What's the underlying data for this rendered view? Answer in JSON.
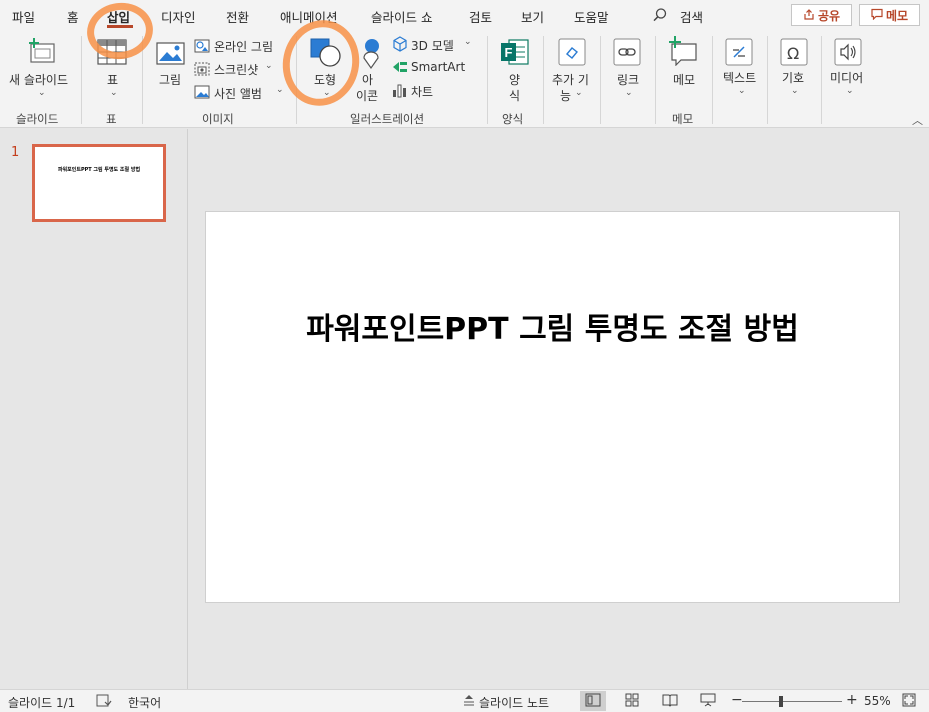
{
  "menu": {
    "tabs": [
      "파일",
      "홈",
      "삽입",
      "디자인",
      "전환",
      "애니메이션",
      "슬라이드 쇼",
      "검토",
      "보기",
      "도움말"
    ],
    "search": "검색",
    "share_label": "공유",
    "comment_label": "메모"
  },
  "ribbon": {
    "new_slide": "새 슬라이드",
    "table": "표",
    "picture": "그림",
    "online_picture": "온라인 그림",
    "screenshot": "스크린샷",
    "photo_album": "사진 앨범",
    "shapes": "도형",
    "icons_top": "아",
    "icons_bottom": "이콘",
    "model3d": "3D 모델",
    "smartart": "SmartArt",
    "chart": "차트",
    "forms_top": "양",
    "forms_bottom": "식",
    "addins_top": "추가 기",
    "addins_bottom": "능",
    "link": "링크",
    "comment": "메모",
    "text": "텍스트",
    "symbols": "기호",
    "media": "미디어",
    "groups": {
      "slides": "슬라이드",
      "tables": "표",
      "images": "이미지",
      "illustrations": "일러스트레이션",
      "forms": "양식",
      "comments": "메모"
    }
  },
  "slides_panel": {
    "number": "1",
    "thumb_title": "파워포인트PPT 그림 투명도 조절 방법"
  },
  "slide": {
    "title": "파워포인트PPT 그림 투명도 조절 방법"
  },
  "status": {
    "slide_count": "슬라이드 1/1",
    "language": "한국어",
    "notes": "슬라이드 노트",
    "zoom_minus": "−",
    "zoom_plus": "+",
    "zoom": "55%",
    "zoom_level_fraction": 0.55
  },
  "colors": {
    "accent": "#b7472a",
    "annotation": "#f79147",
    "thumb_border": "#d9664a"
  }
}
